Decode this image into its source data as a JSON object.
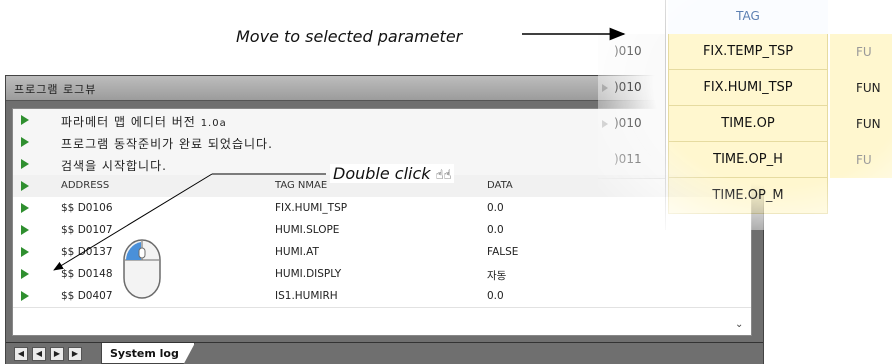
{
  "annotations": {
    "move": "Move to selected parameter",
    "double_click": "Double click"
  },
  "log_window": {
    "title": "프로그램 로그뷰",
    "messages": [
      {
        "text": "파라메터 맵 에디터 버전",
        "version": "1.0a"
      },
      {
        "text": "프로그램 동작준비가 완료 되었습니다."
      },
      {
        "text": "검색을 시작합니다."
      }
    ],
    "columns": [
      "ADDRESS",
      "TAG NMAE",
      "DATA"
    ],
    "rows": [
      {
        "address": "$$  D0106",
        "tag": "FIX.HUMI_TSP",
        "data": "0.0"
      },
      {
        "address": "$$  D0107",
        "tag": "HUMI.SLOPE",
        "data": "0.0"
      },
      {
        "address": "$$  D0137",
        "tag": "HUMI.AT",
        "data": "FALSE"
      },
      {
        "address": "$$  D0148",
        "tag": "HUMI.DISPLY",
        "data": "자동"
      },
      {
        "address": "$$  D0407",
        "tag": "IS1.HUMIRH",
        "data": "0.0"
      }
    ],
    "tab_label": "System log",
    "nav_icons": [
      "first-icon",
      "prev-icon",
      "next-icon",
      "last-icon"
    ]
  },
  "zoom": {
    "header": "TAG",
    "rows": [
      {
        "addr": ")010",
        "tag": "FIX.TEMP_TSP",
        "func": "FU"
      },
      {
        "addr": ")010",
        "tag": "FIX.HUMI_TSP",
        "func": "FUN"
      },
      {
        "addr": ")010",
        "tag": "TIME.OP",
        "func": "FUN"
      },
      {
        "addr": ")011",
        "tag": "TIME.OP_H",
        "func": "FU"
      },
      {
        "addr": "",
        "tag": "TIME.OP_M",
        "func": ""
      }
    ]
  },
  "colors": {
    "tag_highlight": "#fff7cf",
    "row_marker": "#2f8f2f",
    "window_frame": "#6f6f6f"
  }
}
